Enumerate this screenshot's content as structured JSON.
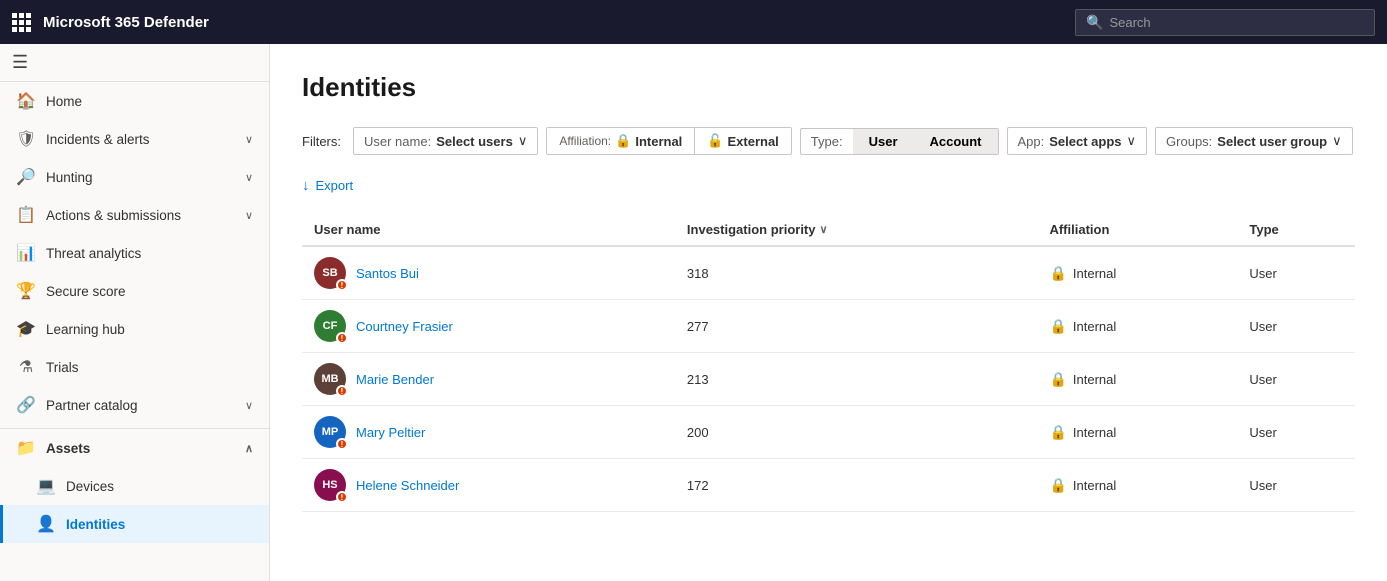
{
  "topbar": {
    "title": "Microsoft 365 Defender",
    "search_placeholder": "Search"
  },
  "sidebar": {
    "hamburger": "☰",
    "items": [
      {
        "id": "home",
        "label": "Home",
        "icon": "🏠",
        "hasChevron": false,
        "active": false
      },
      {
        "id": "incidents",
        "label": "Incidents & alerts",
        "icon": "🛡",
        "hasChevron": true,
        "active": false
      },
      {
        "id": "hunting",
        "label": "Hunting",
        "icon": "🔎",
        "hasChevron": true,
        "active": false
      },
      {
        "id": "actions",
        "label": "Actions & submissions",
        "icon": "📋",
        "hasChevron": true,
        "active": false
      },
      {
        "id": "threat",
        "label": "Threat analytics",
        "icon": "📊",
        "hasChevron": false,
        "active": false
      },
      {
        "id": "secure",
        "label": "Secure score",
        "icon": "🏆",
        "hasChevron": false,
        "active": false
      },
      {
        "id": "learning",
        "label": "Learning hub",
        "icon": "🎓",
        "hasChevron": false,
        "active": false
      },
      {
        "id": "trials",
        "label": "Trials",
        "icon": "⚗",
        "hasChevron": false,
        "active": false
      },
      {
        "id": "partner",
        "label": "Partner catalog",
        "icon": "🔗",
        "hasChevron": true,
        "active": false
      }
    ],
    "assets_section": {
      "label": "Assets",
      "items": [
        {
          "id": "devices",
          "label": "Devices",
          "icon": "💻",
          "active": false
        },
        {
          "id": "identities",
          "label": "Identities",
          "icon": "👤",
          "active": true
        }
      ]
    }
  },
  "page": {
    "title": "Identities",
    "filters_label": "Filters:",
    "username_filter_label": "User name:",
    "username_filter_value": "Select users",
    "affiliation_label": "Affiliation:",
    "affiliation_internal": "Internal",
    "affiliation_external": "External",
    "type_label": "Type:",
    "type_user": "User",
    "type_account": "Account",
    "app_label": "App:",
    "app_value": "Select apps",
    "groups_label": "Groups:",
    "groups_value": "Select user group",
    "export_label": "Export"
  },
  "table": {
    "columns": [
      {
        "id": "username",
        "label": "User name"
      },
      {
        "id": "priority",
        "label": "Investigation priority"
      },
      {
        "id": "affiliation",
        "label": "Affiliation"
      },
      {
        "id": "type",
        "label": "Type"
      }
    ],
    "rows": [
      {
        "id": 1,
        "name": "Santos Bui",
        "initials": "SB",
        "avatar_color": "#8a2c2c",
        "has_photo": true,
        "photo_color": "#6b3030",
        "priority": "318",
        "affiliation": "Internal",
        "type": "User"
      },
      {
        "id": 2,
        "name": "Courtney Frasier",
        "initials": "CF",
        "avatar_color": "#2e7d32",
        "has_photo": false,
        "priority": "277",
        "affiliation": "Internal",
        "type": "User"
      },
      {
        "id": 3,
        "name": "Marie Bender",
        "initials": "MB",
        "avatar_color": "#5d4037",
        "has_photo": false,
        "priority": "213",
        "affiliation": "Internal",
        "type": "User"
      },
      {
        "id": 4,
        "name": "Mary Peltier",
        "initials": "MP",
        "avatar_color": "#1565c0",
        "has_photo": false,
        "priority": "200",
        "affiliation": "Internal",
        "type": "User"
      },
      {
        "id": 5,
        "name": "Helene Schneider",
        "initials": "HS",
        "avatar_color": "#880e4f",
        "has_photo": true,
        "photo_color": "#7b1fa2",
        "priority": "172",
        "affiliation": "Internal",
        "type": "User"
      }
    ]
  }
}
